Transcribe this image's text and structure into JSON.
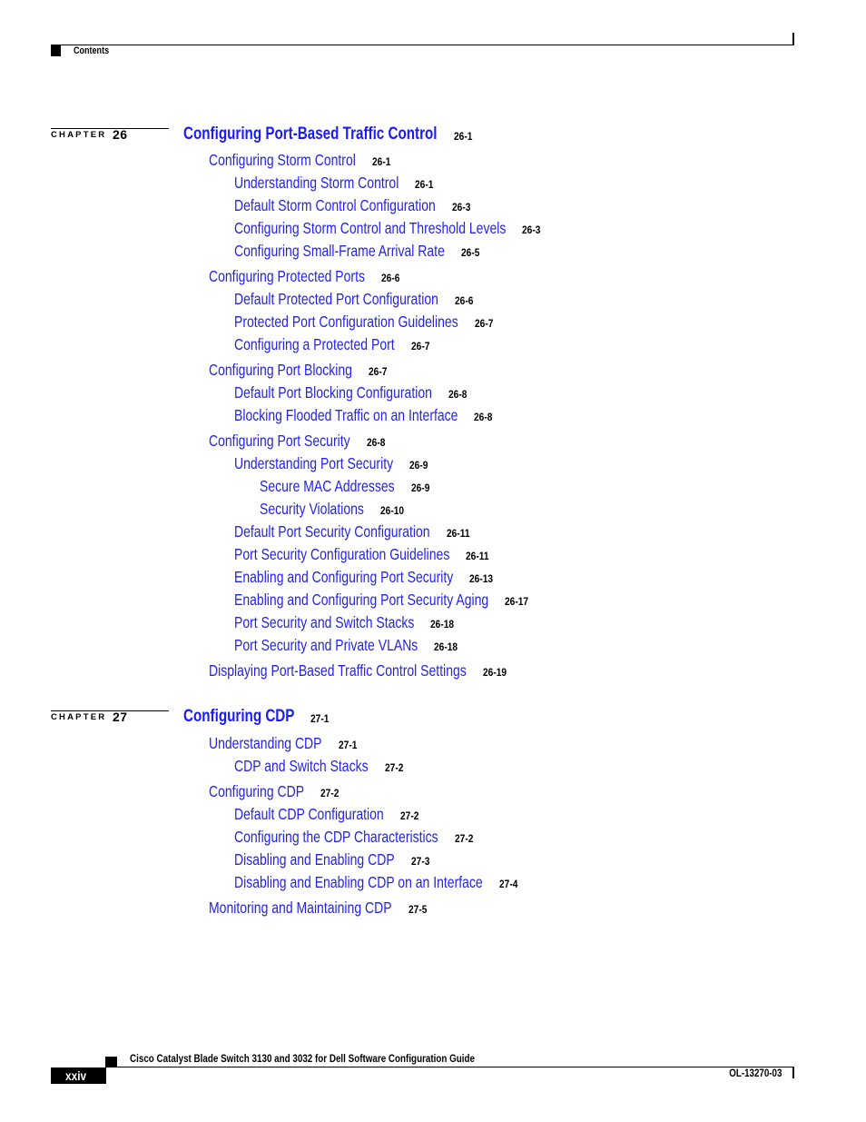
{
  "header": {
    "section_label": "Contents"
  },
  "chapters": [
    {
      "label": "CHAPTER",
      "number": "26",
      "title": "Configuring Port-Based Traffic Control",
      "page": "26-1",
      "entries": [
        {
          "level": 1,
          "text": "Configuring Storm Control",
          "page": "26-1"
        },
        {
          "level": 2,
          "text": "Understanding Storm Control",
          "page": "26-1"
        },
        {
          "level": 2,
          "text": "Default Storm Control Configuration",
          "page": "26-3"
        },
        {
          "level": 2,
          "text": "Configuring Storm Control and Threshold Levels",
          "page": "26-3"
        },
        {
          "level": 2,
          "text": "Configuring Small-Frame Arrival Rate",
          "page": "26-5"
        },
        {
          "level": 1,
          "text": "Configuring Protected Ports",
          "page": "26-6"
        },
        {
          "level": 2,
          "text": "Default Protected Port Configuration",
          "page": "26-6"
        },
        {
          "level": 2,
          "text": "Protected Port Configuration Guidelines",
          "page": "26-7"
        },
        {
          "level": 2,
          "text": "Configuring a Protected Port",
          "page": "26-7"
        },
        {
          "level": 1,
          "text": "Configuring Port Blocking",
          "page": "26-7"
        },
        {
          "level": 2,
          "text": "Default Port Blocking Configuration",
          "page": "26-8"
        },
        {
          "level": 2,
          "text": "Blocking Flooded Traffic on an Interface",
          "page": "26-8"
        },
        {
          "level": 1,
          "text": "Configuring Port Security",
          "page": "26-8"
        },
        {
          "level": 2,
          "text": "Understanding Port Security",
          "page": "26-9"
        },
        {
          "level": 3,
          "text": "Secure MAC Addresses",
          "page": "26-9"
        },
        {
          "level": 3,
          "text": "Security Violations",
          "page": "26-10"
        },
        {
          "level": 2,
          "text": "Default Port Security Configuration",
          "page": "26-11"
        },
        {
          "level": 2,
          "text": "Port Security Configuration Guidelines",
          "page": "26-11"
        },
        {
          "level": 2,
          "text": "Enabling and Configuring Port Security",
          "page": "26-13"
        },
        {
          "level": 2,
          "text": "Enabling and Configuring Port Security Aging",
          "page": "26-17"
        },
        {
          "level": 2,
          "text": "Port Security and Switch Stacks",
          "page": "26-18"
        },
        {
          "level": 2,
          "text": "Port Security and Private VLANs",
          "page": "26-18"
        },
        {
          "level": 1,
          "text": "Displaying Port-Based Traffic Control Settings",
          "page": "26-19"
        }
      ]
    },
    {
      "label": "CHAPTER",
      "number": "27",
      "title": "Configuring CDP",
      "page": "27-1",
      "entries": [
        {
          "level": 1,
          "text": "Understanding CDP",
          "page": "27-1"
        },
        {
          "level": 2,
          "text": "CDP and Switch Stacks",
          "page": "27-2"
        },
        {
          "level": 1,
          "text": "Configuring CDP",
          "page": "27-2"
        },
        {
          "level": 2,
          "text": "Default CDP Configuration",
          "page": "27-2"
        },
        {
          "level": 2,
          "text": "Configuring the CDP Characteristics",
          "page": "27-2"
        },
        {
          "level": 2,
          "text": "Disabling and Enabling CDP",
          "page": "27-3"
        },
        {
          "level": 2,
          "text": "Disabling and Enabling CDP on an Interface",
          "page": "27-4"
        },
        {
          "level": 1,
          "text": "Monitoring and Maintaining CDP",
          "page": "27-5"
        }
      ]
    }
  ],
  "footer": {
    "book_title": "Cisco Catalyst Blade Switch 3130 and 3032 for Dell Software Configuration Guide",
    "page_number": "xxiv",
    "doc_id": "OL-13270-03"
  }
}
